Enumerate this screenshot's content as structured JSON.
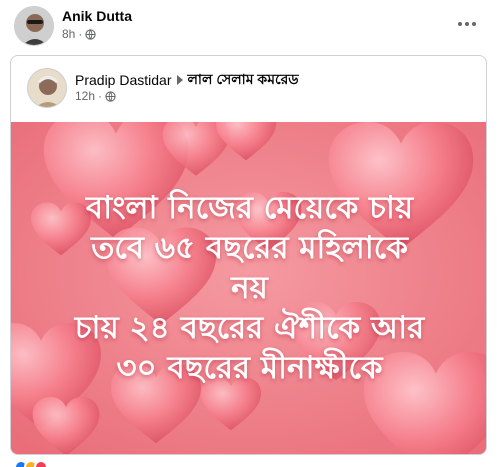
{
  "post": {
    "author": "Anik Dutta",
    "time": "8h",
    "privacy_icon": "globe-icon"
  },
  "shared": {
    "author": "Pradip Dastidar",
    "group": "লাল সেলাম কমরেড",
    "time": "12h",
    "privacy_icon": "globe-icon"
  },
  "image": {
    "background_color": "#ec7d87",
    "lines": [
      "বাংলা নিজের মেয়েকে চায়",
      "তবে ৬৫ বছরের মহিলাকে",
      "নয়",
      "চায় ২৪ বছরের ঐশীকে আর",
      "৩০ বছরের মীনাক্ষীকে"
    ]
  },
  "colors": {
    "text_secondary": "#65676b",
    "card_border": "#ced0d4",
    "like_blue": "#1877f2",
    "love_red": "#f33e58"
  }
}
